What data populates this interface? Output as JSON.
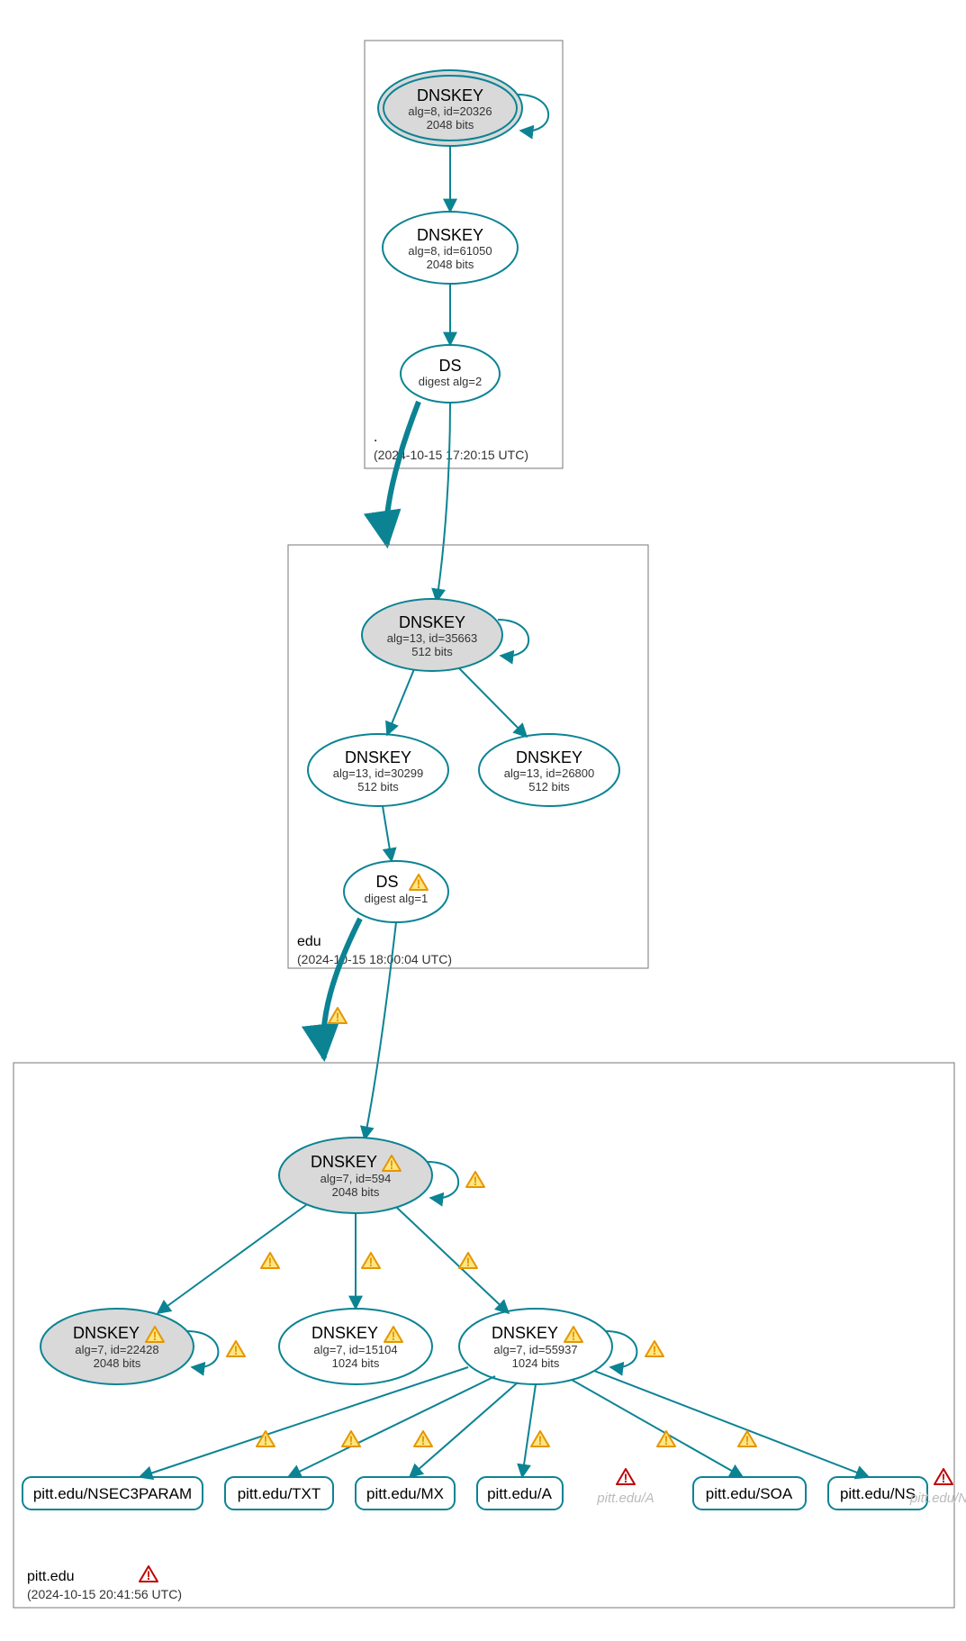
{
  "zones": {
    "root": {
      "name": ".",
      "time": "(2024-10-15 17:20:15 UTC)"
    },
    "edu": {
      "name": "edu",
      "time": "(2024-10-15 18:00:04 UTC)"
    },
    "pitt": {
      "name": "pitt.edu",
      "time": "(2024-10-15 20:41:56 UTC)"
    }
  },
  "nodes": {
    "root_ksk": {
      "title": "DNSKEY",
      "l1": "alg=8, id=20326",
      "l2": "2048 bits"
    },
    "root_zsk": {
      "title": "DNSKEY",
      "l1": "alg=8, id=61050",
      "l2": "2048 bits"
    },
    "root_ds": {
      "title": "DS",
      "l1": "digest alg=2",
      "l2": ""
    },
    "edu_ksk": {
      "title": "DNSKEY",
      "l1": "alg=13, id=35663",
      "l2": "512 bits"
    },
    "edu_zsk1": {
      "title": "DNSKEY",
      "l1": "alg=13, id=30299",
      "l2": "512 bits"
    },
    "edu_zsk2": {
      "title": "DNSKEY",
      "l1": "alg=13, id=26800",
      "l2": "512 bits"
    },
    "edu_ds": {
      "title": "DS",
      "l1": "digest alg=1",
      "l2": ""
    },
    "pitt_ksk": {
      "title": "DNSKEY",
      "l1": "alg=7, id=594",
      "l2": "2048 bits"
    },
    "pitt_zsk1": {
      "title": "DNSKEY",
      "l1": "alg=7, id=22428",
      "l2": "2048 bits"
    },
    "pitt_zsk2": {
      "title": "DNSKEY",
      "l1": "alg=7, id=15104",
      "l2": "1024 bits"
    },
    "pitt_zsk3": {
      "title": "DNSKEY",
      "l1": "alg=7, id=55937",
      "l2": "1024 bits"
    }
  },
  "rr": {
    "nsec3": "pitt.edu/NSEC3PARAM",
    "txt": "pitt.edu/TXT",
    "mx": "pitt.edu/MX",
    "a": "pitt.edu/A",
    "a2": "pitt.edu/A",
    "soa": "pitt.edu/SOA",
    "ns": "pitt.edu/NS",
    "ns2": "pitt.edu/NS"
  }
}
